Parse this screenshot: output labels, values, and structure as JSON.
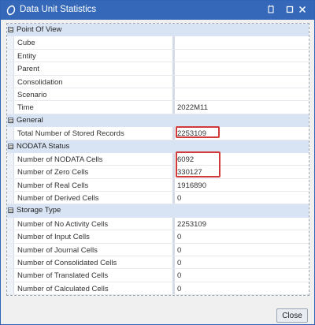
{
  "window": {
    "title": "Data Unit Statistics",
    "controls": {
      "restore_icon": "restore-icon",
      "maximize_icon": "maximize-icon",
      "close_icon": "close-icon"
    }
  },
  "groups": [
    {
      "label": "Point Of View",
      "expander": "⊟",
      "items": [
        {
          "label": "Cube",
          "value": ""
        },
        {
          "label": "Entity",
          "value": ""
        },
        {
          "label": "Parent",
          "value": ""
        },
        {
          "label": "Consolidation",
          "value": ""
        },
        {
          "label": "Scenario",
          "value": ""
        },
        {
          "label": "Time",
          "value": "2022M11"
        }
      ]
    },
    {
      "label": "General",
      "expander": "⊟",
      "items": [
        {
          "label": "Total Number of Stored Records",
          "value": "2253109"
        }
      ]
    },
    {
      "label": "NODATA Status",
      "expander": "⊟",
      "items": [
        {
          "label": "Number of NODATA Cells",
          "value": "6092"
        },
        {
          "label": "Number of Zero Cells",
          "value": "330127"
        },
        {
          "label": "Number of Real Cells",
          "value": "1916890"
        },
        {
          "label": "Number of Derived Cells",
          "value": "0"
        }
      ]
    },
    {
      "label": "Storage Type",
      "expander": "⊟",
      "items": [
        {
          "label": "Number of No Activity Cells",
          "value": "2253109"
        },
        {
          "label": "Number of Input Cells",
          "value": "0"
        },
        {
          "label": "Number of Journal Cells",
          "value": "0"
        },
        {
          "label": "Number of Consolidated Cells",
          "value": "0"
        },
        {
          "label": "Number of Translated Cells",
          "value": "0"
        },
        {
          "label": "Number of Calculated Cells",
          "value": "0"
        }
      ]
    }
  ],
  "footer": {
    "close_label": "Close"
  },
  "colors": {
    "titlebar": "#3568b8",
    "group_header": "#d8e4f3",
    "highlight": "#d23a3a"
  }
}
